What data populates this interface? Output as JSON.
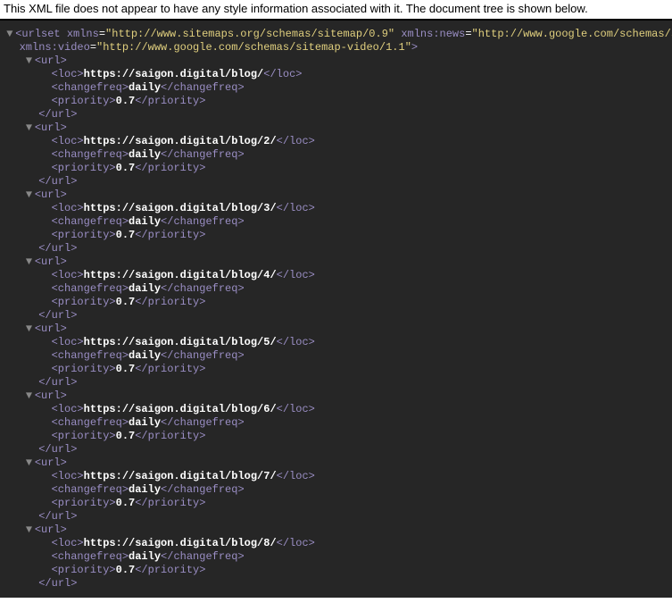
{
  "header_text": "This XML file does not appear to have any style information associated with it. The document tree is shown below.",
  "root": {
    "tag": "urlset",
    "attrs": [
      {
        "name": "xmlns",
        "value": "http://www.sitemaps.org/schemas/sitemap/0.9"
      },
      {
        "name": "xmlns:news",
        "value": "http://www.google.com/schemas/s"
      },
      {
        "name": "xmlns:video",
        "value": "http://www.google.com/schemas/sitemap-video/1.1"
      }
    ]
  },
  "urls": [
    {
      "loc": "https://saigon.digital/blog/",
      "changefreq": "daily",
      "priority": "0.7"
    },
    {
      "loc": "https://saigon.digital/blog/2/",
      "changefreq": "daily",
      "priority": "0.7"
    },
    {
      "loc": "https://saigon.digital/blog/3/",
      "changefreq": "daily",
      "priority": "0.7"
    },
    {
      "loc": "https://saigon.digital/blog/4/",
      "changefreq": "daily",
      "priority": "0.7"
    },
    {
      "loc": "https://saigon.digital/blog/5/",
      "changefreq": "daily",
      "priority": "0.7"
    },
    {
      "loc": "https://saigon.digital/blog/6/",
      "changefreq": "daily",
      "priority": "0.7"
    },
    {
      "loc": "https://saigon.digital/blog/7/",
      "changefreq": "daily",
      "priority": "0.7"
    },
    {
      "loc": "https://saigon.digital/blog/8/",
      "changefreq": "daily",
      "priority": "0.7"
    }
  ],
  "tokens": {
    "url_open": "url",
    "url_close": "/url",
    "loc_open": "loc",
    "loc_close": "/loc",
    "cf_open": "changefreq",
    "cf_close": "/changefreq",
    "pr_open": "priority",
    "pr_close": "/priority"
  }
}
